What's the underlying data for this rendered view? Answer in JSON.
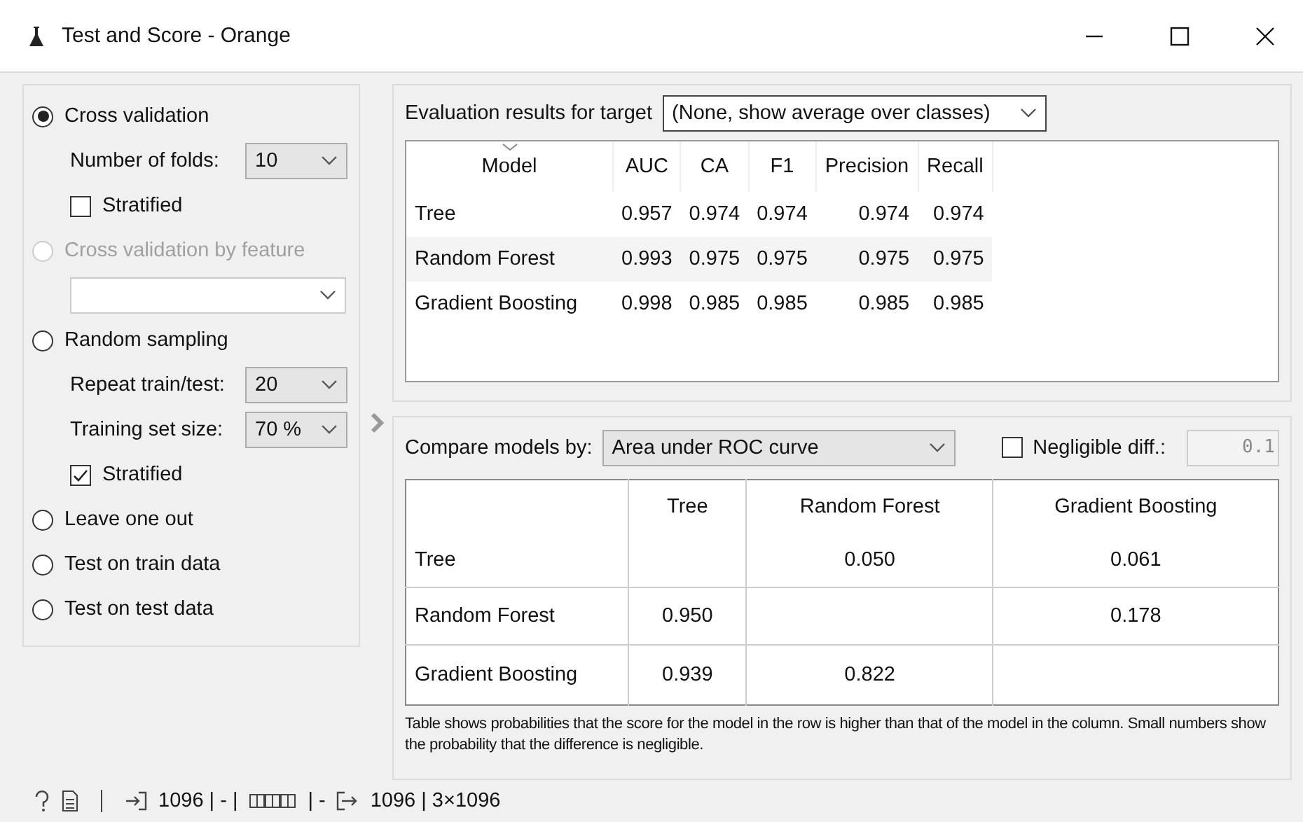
{
  "window": {
    "title": "Test and Score - Orange"
  },
  "methods": [
    {
      "label": "Cross validation",
      "selected": true,
      "disabled": false,
      "settings": [
        {
          "kind": "combo",
          "label": "Number of folds:",
          "value": "10"
        },
        {
          "kind": "checkbox",
          "label": "Stratified",
          "checked": false
        }
      ]
    },
    {
      "label": "Cross validation by feature",
      "selected": false,
      "disabled": true,
      "settings": [
        {
          "kind": "combo"
        }
      ]
    },
    {
      "label": "Random sampling",
      "selected": false,
      "disabled": false,
      "settings": [
        {
          "kind": "combo",
          "label": "Repeat train/test:",
          "value": "20"
        },
        {
          "kind": "combo",
          "label": "Training set size:",
          "value": "70 %"
        },
        {
          "kind": "checkbox",
          "label": "Stratified",
          "checked": true
        }
      ]
    },
    {
      "label": "Leave one out",
      "selected": false,
      "disabled": false
    },
    {
      "label": "Test on train data",
      "selected": false,
      "disabled": false
    },
    {
      "label": "Test on test data",
      "selected": false,
      "disabled": false
    }
  ],
  "evaluation": {
    "label": "Evaluation results for target",
    "target": "(None, show average over classes)",
    "columns": [
      {
        "label": "Model",
        "sorted": true
      },
      {
        "label": "AUC",
        "sorted": false
      },
      {
        "label": "CA",
        "sorted": false
      },
      {
        "label": "F1",
        "sorted": false
      },
      {
        "label": "Precision",
        "sorted": false
      },
      {
        "label": "Recall",
        "sorted": false
      }
    ],
    "rows": [
      [
        "Tree",
        "0.957",
        "0.974",
        "0.974",
        "0.974",
        "0.974"
      ],
      [
        "Random Forest",
        "0.993",
        "0.975",
        "0.975",
        "0.975",
        "0.975"
      ],
      [
        "Gradient Boosting",
        "0.998",
        "0.985",
        "0.985",
        "0.985",
        "0.985"
      ]
    ]
  },
  "comparison": {
    "label": "Compare models by:",
    "metric": "Area under ROC curve",
    "negligible": {
      "label": "Negligible diff.:",
      "checked": false,
      "value": "0.1"
    },
    "columns": [
      "Tree",
      "Random Forest",
      "Gradient Boosting"
    ],
    "rows": [
      {
        "model": "Tree",
        "cells": [
          null,
          "0.050",
          "0.061"
        ]
      },
      {
        "model": "Random Forest",
        "cells": [
          "0.950",
          null,
          "0.178"
        ]
      },
      {
        "model": "Gradient Boosting",
        "cells": [
          "0.939",
          "0.822",
          null
        ]
      }
    ],
    "note": "Table shows probabilities that the score for the model in the row is higher than that of the model in the column. Small numbers show the probability that the difference is negligible."
  },
  "status_bar": {
    "input": "1096 | - |",
    "input_tail": "| -",
    "output": "1096 | 3×1096"
  }
}
